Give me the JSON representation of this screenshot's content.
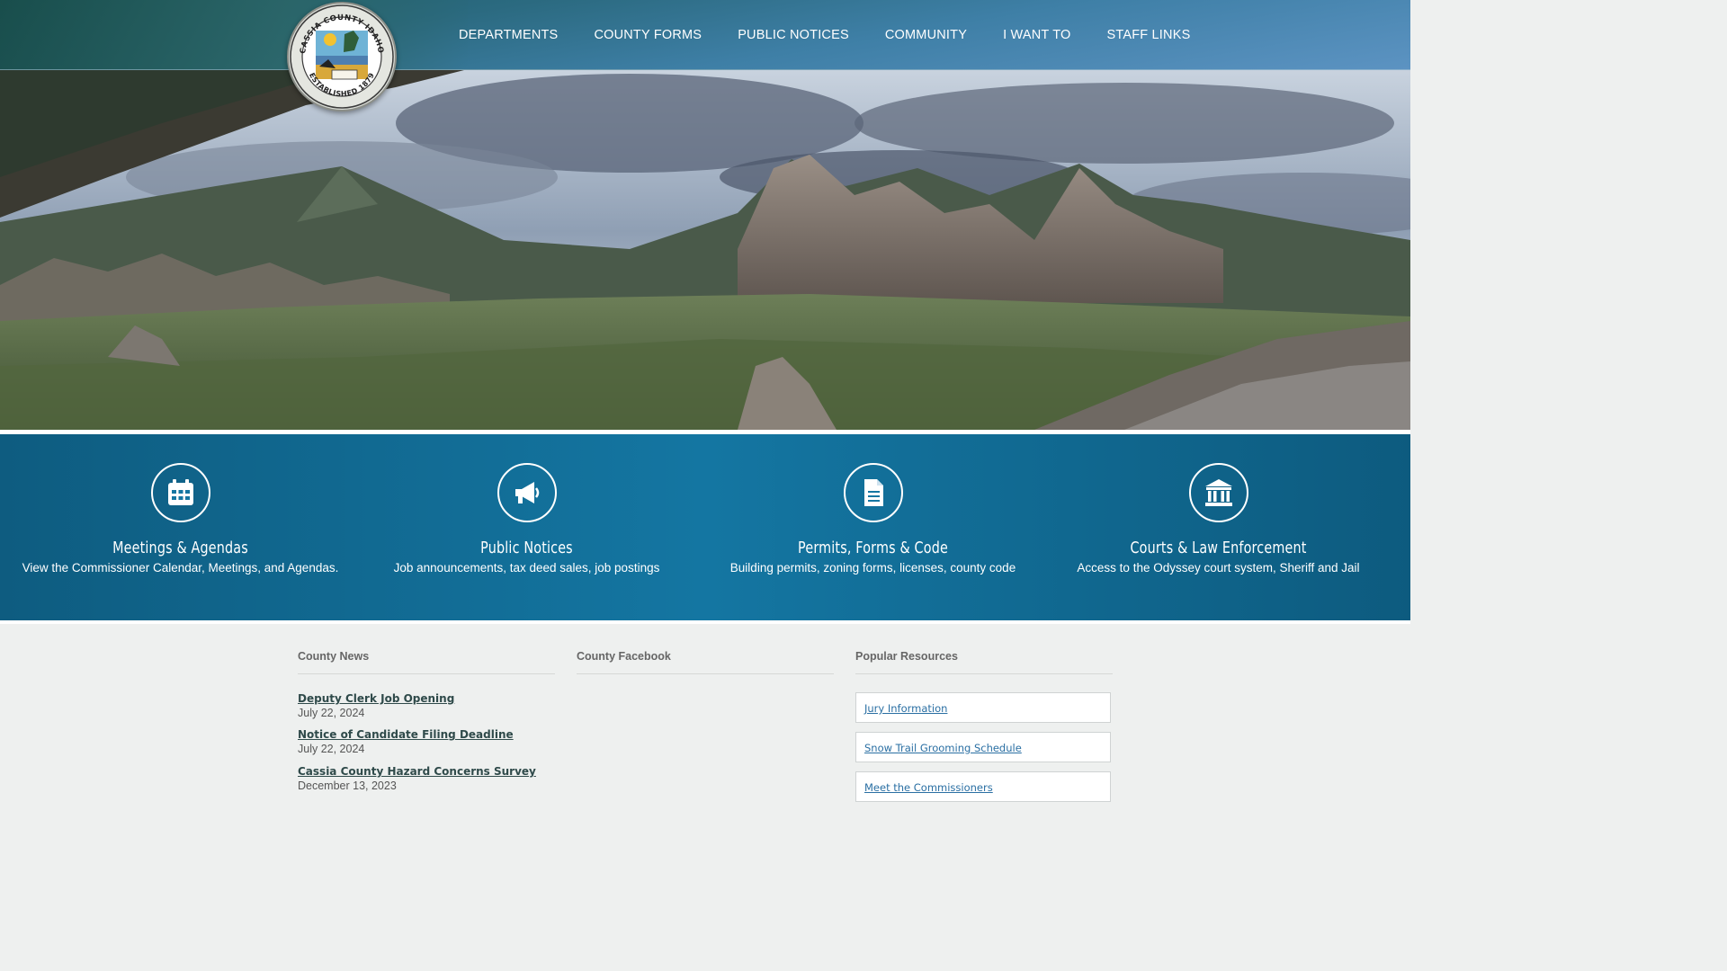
{
  "logo": {
    "text_top": "CASSIA COUNTY IDAHO",
    "text_bottom": "ESTABLISHED 1879"
  },
  "nav": {
    "items": [
      {
        "label": "DEPARTMENTS"
      },
      {
        "label": "COUNTY FORMS"
      },
      {
        "label": "PUBLIC NOTICES"
      },
      {
        "label": "COMMUNITY"
      },
      {
        "label": "I WANT TO"
      },
      {
        "label": "STAFF LINKS"
      }
    ]
  },
  "quick_links": [
    {
      "icon": "calendar-icon",
      "title": "Meetings & Agendas",
      "desc": "View the Commissioner Calendar, Meetings, and Agendas."
    },
    {
      "icon": "megaphone-icon",
      "title": "Public Notices",
      "desc": "Job announcements, tax deed sales, job postings"
    },
    {
      "icon": "document-icon",
      "title": "Permits, Forms & Code",
      "desc": "Building permits, zoning forms, licenses, county code"
    },
    {
      "icon": "courthouse-icon",
      "title": "Courts & Law Enforcement",
      "desc": "Access to the Odyssey court system, Sheriff and Jail"
    }
  ],
  "county_news": {
    "heading": "County News",
    "items": [
      {
        "title": "Deputy Clerk Job Opening",
        "date": "July 22, 2024"
      },
      {
        "title": "Notice of Candidate Filing Deadline",
        "date": "July 22, 2024"
      },
      {
        "title": "Cassia County Hazard Concerns Survey",
        "date": "December 13, 2023"
      }
    ]
  },
  "county_facebook": {
    "heading": "County Facebook"
  },
  "popular_resources": {
    "heading": "Popular Resources",
    "items": [
      {
        "label": "Jury Information"
      },
      {
        "label": "Snow Trail Grooming Schedule"
      },
      {
        "label": "Meet the Commissioners"
      }
    ]
  },
  "colors": {
    "band": "#1476a2",
    "link": "#2a6fa3",
    "news_title": "#2f4a4a"
  }
}
